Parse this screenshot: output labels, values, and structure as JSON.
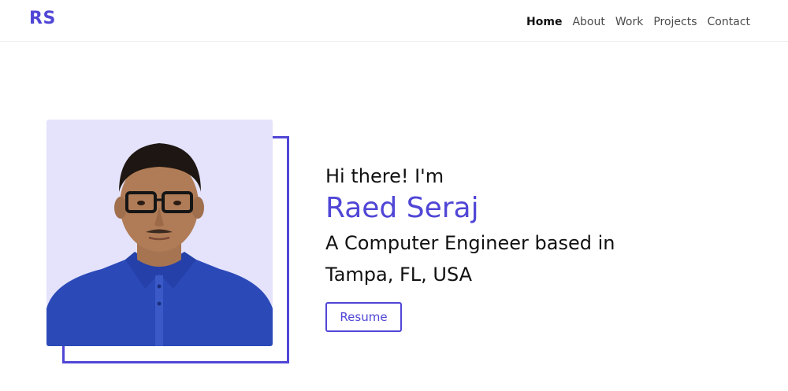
{
  "nav": {
    "logo": "RS",
    "links": [
      {
        "label": "Home",
        "active": true
      },
      {
        "label": "About",
        "active": false
      },
      {
        "label": "Work",
        "active": false
      },
      {
        "label": "Projects",
        "active": false
      },
      {
        "label": "Contact",
        "active": false
      }
    ]
  },
  "hero": {
    "greeting": "Hi there! I'm",
    "name": "Raed Seraj",
    "tagline": "A Computer Engineer based in Tampa, FL, USA",
    "resume_label": "Resume"
  },
  "colors": {
    "accent": "#5046d6",
    "photo_background": "#e4e3fb",
    "shirt": "#2c49b8"
  }
}
